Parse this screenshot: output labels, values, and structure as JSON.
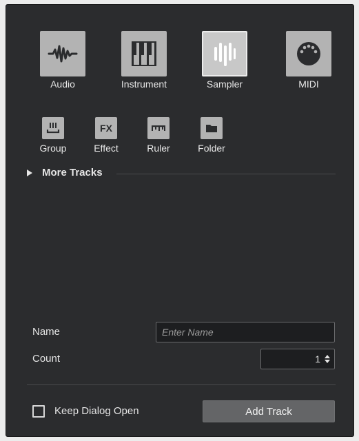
{
  "track_types": [
    {
      "label": "Audio",
      "icon": "audio-waveform-icon"
    },
    {
      "label": "Instrument",
      "icon": "piano-keys-icon"
    },
    {
      "label": "Sampler",
      "icon": "sampler-bars-icon",
      "selected": true
    },
    {
      "label": "MIDI",
      "icon": "midi-port-icon"
    }
  ],
  "secondary_types": [
    {
      "label": "Group",
      "icon": "group-icon"
    },
    {
      "label": "Effect",
      "icon": "fx-icon",
      "icon_text": "FX"
    },
    {
      "label": "Ruler",
      "icon": "ruler-icon"
    },
    {
      "label": "Folder",
      "icon": "folder-icon"
    }
  ],
  "more_tracks": {
    "label": "More Tracks"
  },
  "form": {
    "name_label": "Name",
    "name_value": "",
    "name_placeholder": "Enter Name",
    "count_label": "Count",
    "count_value": "1"
  },
  "footer": {
    "keep_open_label": "Keep Dialog Open",
    "keep_open_checked": false,
    "add_button_label": "Add Track"
  },
  "colors": {
    "dialog_bg": "#2b2c2e",
    "tile_bg": "#b3b3b3",
    "icon_dark": "#2b2c2e",
    "text": "#e6e6e6",
    "button_bg": "#646567"
  }
}
